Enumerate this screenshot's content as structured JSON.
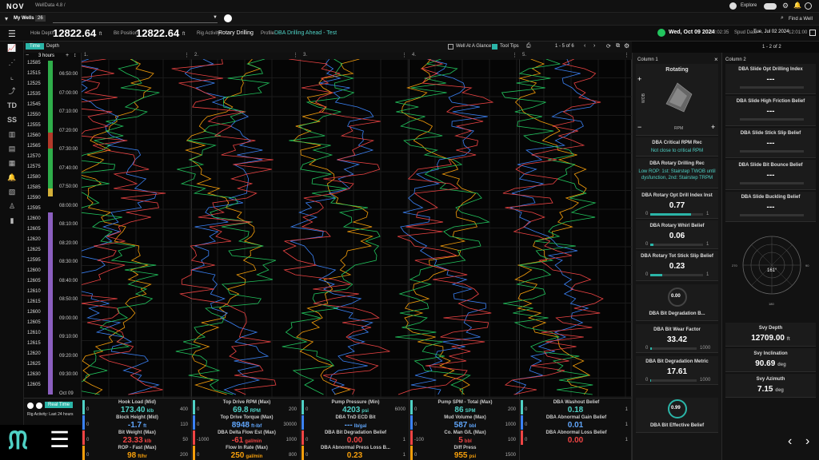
{
  "app": {
    "logo": "NOV",
    "title": "WellData 4.8 /",
    "explore": "Explore",
    "find_well": "Find a Well"
  },
  "wells": {
    "label": "My Wells",
    "count": "26",
    "date": "Wed, Oct 09 2024",
    "time": "12:02:35",
    "spud_label": "Spud Date",
    "spud_date": "Tue, Jul 02 2024",
    "spud_time": "12:01:00"
  },
  "header": {
    "hole_depth_label": "Hole Depth",
    "hole_depth": "12822.64",
    "hole_unit": "ft",
    "bit_pos_label": "Bit Position",
    "bit_pos": "12822.64",
    "bit_unit": "ft",
    "rig_act_label": "Rig Activity",
    "rig_act": "Rotary Drilling",
    "profile_label": "Profile",
    "profile": "DBA Drilling Ahead - Test"
  },
  "toolbar": {
    "time_tab": "Time",
    "depth_tab": "Depth",
    "range": "3 hours",
    "well_at_glance": "Well At A Glance",
    "tool_tips": "Tool Tips",
    "paging": "1 - 5 of 6",
    "col_paging": "1 - 2 of 2"
  },
  "tracks": [
    "1.",
    "2.",
    "3.",
    "4.",
    "5."
  ],
  "depths": [
    "12585",
    "12515",
    "12525",
    "12535",
    "12545",
    "12550",
    "12555",
    "12560",
    "12565",
    "12570",
    "12575",
    "12580",
    "12585",
    "12590",
    "12595",
    "12600",
    "12605",
    "12620",
    "12625",
    "12595",
    "12600",
    "12605",
    "12610",
    "12615",
    "12600",
    "12605",
    "12610",
    "12615",
    "12620",
    "12625",
    "12630",
    "12605"
  ],
  "times": [
    "06:50:00",
    "07:00:00",
    "07:10:00",
    "07:20:00",
    "07:30:00",
    "07:40:00",
    "07:50:00",
    "08:00:00",
    "08:10:00",
    "08:20:00",
    "08:30:00",
    "08:40:00",
    "08:50:00",
    "09:00:00",
    "09:10:00",
    "09:20:00",
    "09:30:00",
    "Oct 09"
  ],
  "realtime": {
    "label": "Real Time",
    "activity": "Rig Activity: Last 24 hours"
  },
  "bottom": [
    [
      {
        "label": "Hook Load (Mid)",
        "val": "173.40",
        "unit": "klb",
        "min": "0",
        "max": "400",
        "color": "#4fd1c5"
      },
      {
        "label": "Block Height (Mid)",
        "val": "-1.7",
        "unit": "ft",
        "min": "0",
        "max": "110",
        "color": "#3b82f6"
      },
      {
        "label": "Bit Weight (Max)",
        "val": "23.33",
        "unit": "klb",
        "min": "0",
        "max": "50",
        "color": "#ef4444"
      },
      {
        "label": "ROP - Fast (Max)",
        "val": "98",
        "unit": "ft/hr",
        "min": "0",
        "max": "200",
        "color": "#f59e0b"
      }
    ],
    [
      {
        "label": "Top Drive RPM (Max)",
        "val": "69.8",
        "unit": "RPM",
        "min": "0",
        "max": "200",
        "color": "#4fd1c5"
      },
      {
        "label": "Top Drive Torque (Max)",
        "val": "8948",
        "unit": "ft-lbf",
        "min": "0",
        "max": "30000",
        "color": "#3b82f6"
      },
      {
        "label": "DBA Delta Flow Est (Max)",
        "val": "-61",
        "unit": "gal/min",
        "min": "-1000",
        "max": "1000",
        "color": "#ef4444"
      },
      {
        "label": "Flow In Rate (Max)",
        "val": "250",
        "unit": "gal/min",
        "min": "0",
        "max": "800",
        "color": "#f59e0b"
      }
    ],
    [
      {
        "label": "Pump Pressure (Min)",
        "val": "4203",
        "unit": "psi",
        "min": "0",
        "max": "6000",
        "color": "#4fd1c5"
      },
      {
        "label": "DBA TnD ECD Bit",
        "val": "---",
        "unit": "lb/gal",
        "min": "",
        "max": "",
        "color": "#3b82f6"
      },
      {
        "label": "DBA Bit Degradation Belief",
        "val": "0.00",
        "unit": "",
        "min": "0",
        "max": "1",
        "color": "#ef4444"
      },
      {
        "label": "DBA Abnormal Press Loss B...",
        "val": "0.23",
        "unit": "",
        "min": "0",
        "max": "1",
        "color": "#f59e0b"
      }
    ],
    [
      {
        "label": "Pump SPM - Total (Max)",
        "val": "86",
        "unit": "SPM",
        "min": "0",
        "max": "200",
        "color": "#4fd1c5"
      },
      {
        "label": "Mud Volume (Max)",
        "val": "587",
        "unit": "bbl",
        "min": "0",
        "max": "1000",
        "color": "#3b82f6"
      },
      {
        "label": "Co. Man G/L (Max)",
        "val": "5",
        "unit": "bbl",
        "min": "-100",
        "max": "100",
        "color": "#ef4444"
      },
      {
        "label": "Diff Press",
        "val": "955",
        "unit": "psi",
        "min": "0",
        "max": "1500",
        "color": "#f59e0b"
      }
    ],
    [
      {
        "label": "DBA Washout Belief",
        "val": "0.18",
        "unit": "",
        "min": "0",
        "max": "1",
        "color": "#4fd1c5"
      },
      {
        "label": "DBA Abnormal Gain Belief",
        "val": "0.01",
        "unit": "",
        "min": "0",
        "max": "1",
        "color": "#3b82f6"
      },
      {
        "label": "DBA Abnormal Loss Belief",
        "val": "0.00",
        "unit": "",
        "min": "0",
        "max": "1",
        "color": "#ef4444"
      }
    ]
  ],
  "col1": {
    "title": "Column 1",
    "rotating": "Rotating",
    "wob": "WOB",
    "rpm": "RPM",
    "crit_title": "DBA Critical RPM Rec",
    "crit_text": "Not close to critical RPM",
    "rot_title": "DBA Rotary Drilling Rec",
    "rot_text": "Low ROP: 1st: Stairstep TWOB until dysfunction, 2nd: Stairstep TRPM",
    "odi_title": "DBA Rotary Opt Drill Index Inst",
    "odi_val": "0.77",
    "odi_min": "0",
    "odi_max": "1",
    "odi_level": 0.77,
    "whirl_title": "DBA Rotary Whirl Belief",
    "whirl_val": "0.06",
    "whirl_min": "0",
    "whirl_max": "1",
    "whirl_level": 0.06,
    "tss_title": "DBA Rotary Tot Stick Slip Belief",
    "tss_val": "0.23",
    "tss_min": "0",
    "tss_max": "1",
    "tss_level": 0.23,
    "deg_gauge": "0.00",
    "deg_title": "DBA Bit Degradation B...",
    "wear_title": "DBA Bit Wear Factor",
    "wear_val": "33.42",
    "wear_min": "0",
    "wear_max": "1000",
    "wear_level": 0.033,
    "metric_title": "DBA Bit Degradation Metric",
    "metric_val": "17.61",
    "metric_min": "0",
    "metric_max": "1000",
    "metric_level": 0.018,
    "eff_gauge": "0.99",
    "eff_title": "DBA Bit Effective Belief"
  },
  "col2": {
    "title": "Column 2",
    "items": [
      {
        "title": "DBA Slide Opt Drilling Index",
        "val": "---"
      },
      {
        "title": "DBA Slide High Friction Belief",
        "val": "---"
      },
      {
        "title": "DBA Slide Stick Slip Belief",
        "val": "---"
      },
      {
        "title": "DBA Slide Bit Bounce Belief",
        "val": "---"
      },
      {
        "title": "DBA Slide Buckling Belief",
        "val": "---"
      }
    ],
    "compass_val": "161°",
    "compass_left": "270",
    "compass_right": "90",
    "compass_bottom": "180",
    "svy_depth_title": "Svy Depth",
    "svy_depth": "12709.00",
    "svy_depth_unit": "ft",
    "svy_inc_title": "Svy Inclination",
    "svy_inc": "90.69",
    "svy_inc_unit": "deg",
    "svy_az_title": "Svy Azimuth",
    "svy_az": "7.15",
    "svy_az_unit": "deg"
  }
}
